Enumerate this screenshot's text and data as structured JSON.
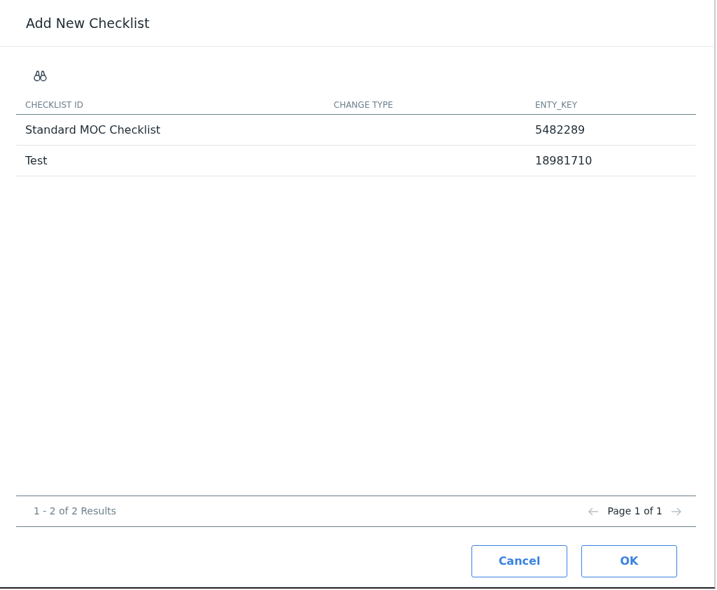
{
  "dialog": {
    "title": "Add New Checklist"
  },
  "table": {
    "columns": [
      "CHECKLIST ID",
      "CHANGE TYPE",
      "ENTY_KEY"
    ],
    "rows": [
      [
        "Standard MOC Checklist",
        "",
        "5482289"
      ],
      [
        "Test",
        "",
        "18981710"
      ]
    ]
  },
  "footer": {
    "results": "1 - 2 of 2 Results",
    "page": "Page 1 of 1",
    "prev_disabled": true,
    "next_disabled": true
  },
  "buttons": [
    "Cancel",
    "OK"
  ]
}
